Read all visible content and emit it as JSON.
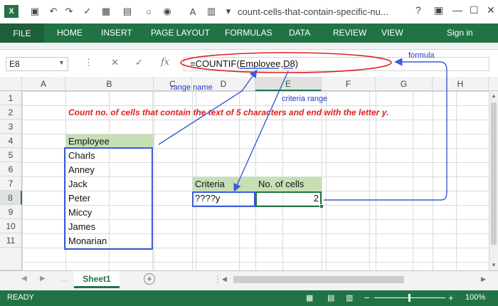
{
  "window": {
    "title": "count-cells-that-contain-specific-nu...",
    "app_logo": "X",
    "help_glyph": "?",
    "minimize_glyph": "—",
    "restore_glyph": "☐",
    "close_glyph": "✕"
  },
  "ribbon": {
    "file_tab": "FILE",
    "tabs": [
      "HOME",
      "INSERT",
      "PAGE LAYOUT",
      "FORMULAS",
      "DATA",
      "REVIEW",
      "VIEW"
    ],
    "sign_in": "Sign in"
  },
  "formula_bar": {
    "name_box": "E8",
    "cancel_glyph": "✕",
    "enter_glyph": "✓",
    "fx_glyph": "fx",
    "formula": "=COUNTIF(Employee,D8)"
  },
  "columns": [
    "A",
    "B",
    "C",
    "D",
    "E",
    "F",
    "G",
    "H"
  ],
  "rows": [
    "1",
    "2",
    "3",
    "4",
    "5",
    "6",
    "7",
    "8",
    "9",
    "10",
    "11"
  ],
  "selected": {
    "column": "E",
    "row": "8"
  },
  "cells": {
    "note": "Count no. of cells that  contain the text of 5 characters and end with the letter y.",
    "employee_header": "Employee",
    "employees": [
      "Charls",
      "Anney",
      "Jack",
      "Peter",
      "Miccy",
      "James",
      "Monarian"
    ],
    "criteria_header": "Criteria",
    "criteria_value": "????y",
    "count_header": "No. of cells",
    "count_value": "2"
  },
  "annotations": {
    "range_name": "range name",
    "criteria_range": "criteria range",
    "formula": "formula"
  },
  "sheets": {
    "active": "Sheet1",
    "add_glyph": "+"
  },
  "status": {
    "mode": "READY",
    "zoom": "100%",
    "zoom_minus": "−",
    "zoom_plus": "+"
  },
  "colors": {
    "accent": "#217346",
    "annotation": "#3b5bdb",
    "note": "#e02020",
    "header_fill": "#c6e0b4"
  }
}
